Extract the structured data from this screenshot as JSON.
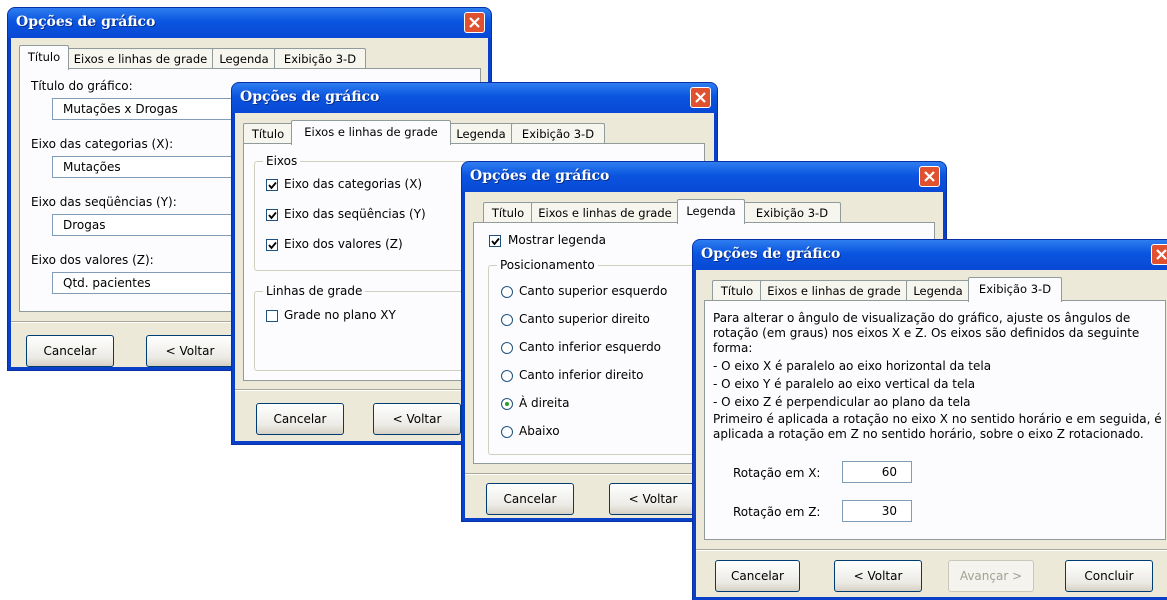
{
  "dialog_title": "Opções de gráfico",
  "tabs": [
    "Título",
    "Eixos e linhas de grade",
    "Legenda",
    "Exibição 3-D"
  ],
  "buttons": {
    "cancel": "Cancelar",
    "back": "< Voltar",
    "next": "Avançar >",
    "finish": "Concluir"
  },
  "titulo_tab": {
    "chart_title_label": "Título do gráfico:",
    "chart_title_value": "Mutações x Drogas",
    "category_axis_label": "Eixo das categorias (X):",
    "category_axis_value": "Mutações",
    "series_axis_label": "Eixo das seqüências (Y):",
    "series_axis_value": "Drogas",
    "value_axis_label": "Eixo dos valores (Z):",
    "value_axis_value": "Qtd. pacientes"
  },
  "eixos_tab": {
    "axes_group": "Eixos",
    "category_axis": "Eixo das categorias (X)",
    "series_axis": "Eixo das seqüências (Y)",
    "value_axis": "Eixo dos valores (Z)",
    "gridlines_group": "Linhas de grade",
    "xy_grid": "Grade no plano XY",
    "checked": {
      "category_axis": true,
      "series_axis": true,
      "value_axis": true,
      "xy_grid": false
    }
  },
  "legenda_tab": {
    "show_legend": "Mostrar legenda",
    "show_legend_checked": true,
    "placement_group": "Posicionamento",
    "options": [
      "Canto superior esquerdo",
      "Canto superior direito",
      "Canto inferior esquerdo",
      "Canto inferior direito",
      "À direita",
      "Abaixo"
    ],
    "selected": "À direita"
  },
  "exibicao_tab": {
    "description": [
      "Para alterar o ângulo de visualização do gráfico, ajuste os ângulos de",
      "rotação (em graus) nos eixos X e Z. Os eixos são definidos da seguinte",
      "forma:",
      "- O eixo X é paralelo ao eixo horizontal da tela",
      "- O eixo Y é paralelo ao eixo vertical da tela",
      "- O eixo Z é perpendicular ao plano da tela",
      "Primeiro é aplicada a rotação no eixo X no sentido horário e em seguida, é",
      "aplicada a rotação em Z no sentido horário, sobre o eixo Z rotacionado."
    ],
    "rotation_x_label": "Rotação em X:",
    "rotation_x_value": "60",
    "rotation_z_label": "Rotação em Z:",
    "rotation_z_value": "30"
  },
  "colors": {
    "titlebar": "#0a55e0",
    "dialog_bg": "#ece9d8",
    "close_button": "#e0512f",
    "radio_dot": "#21a121"
  }
}
